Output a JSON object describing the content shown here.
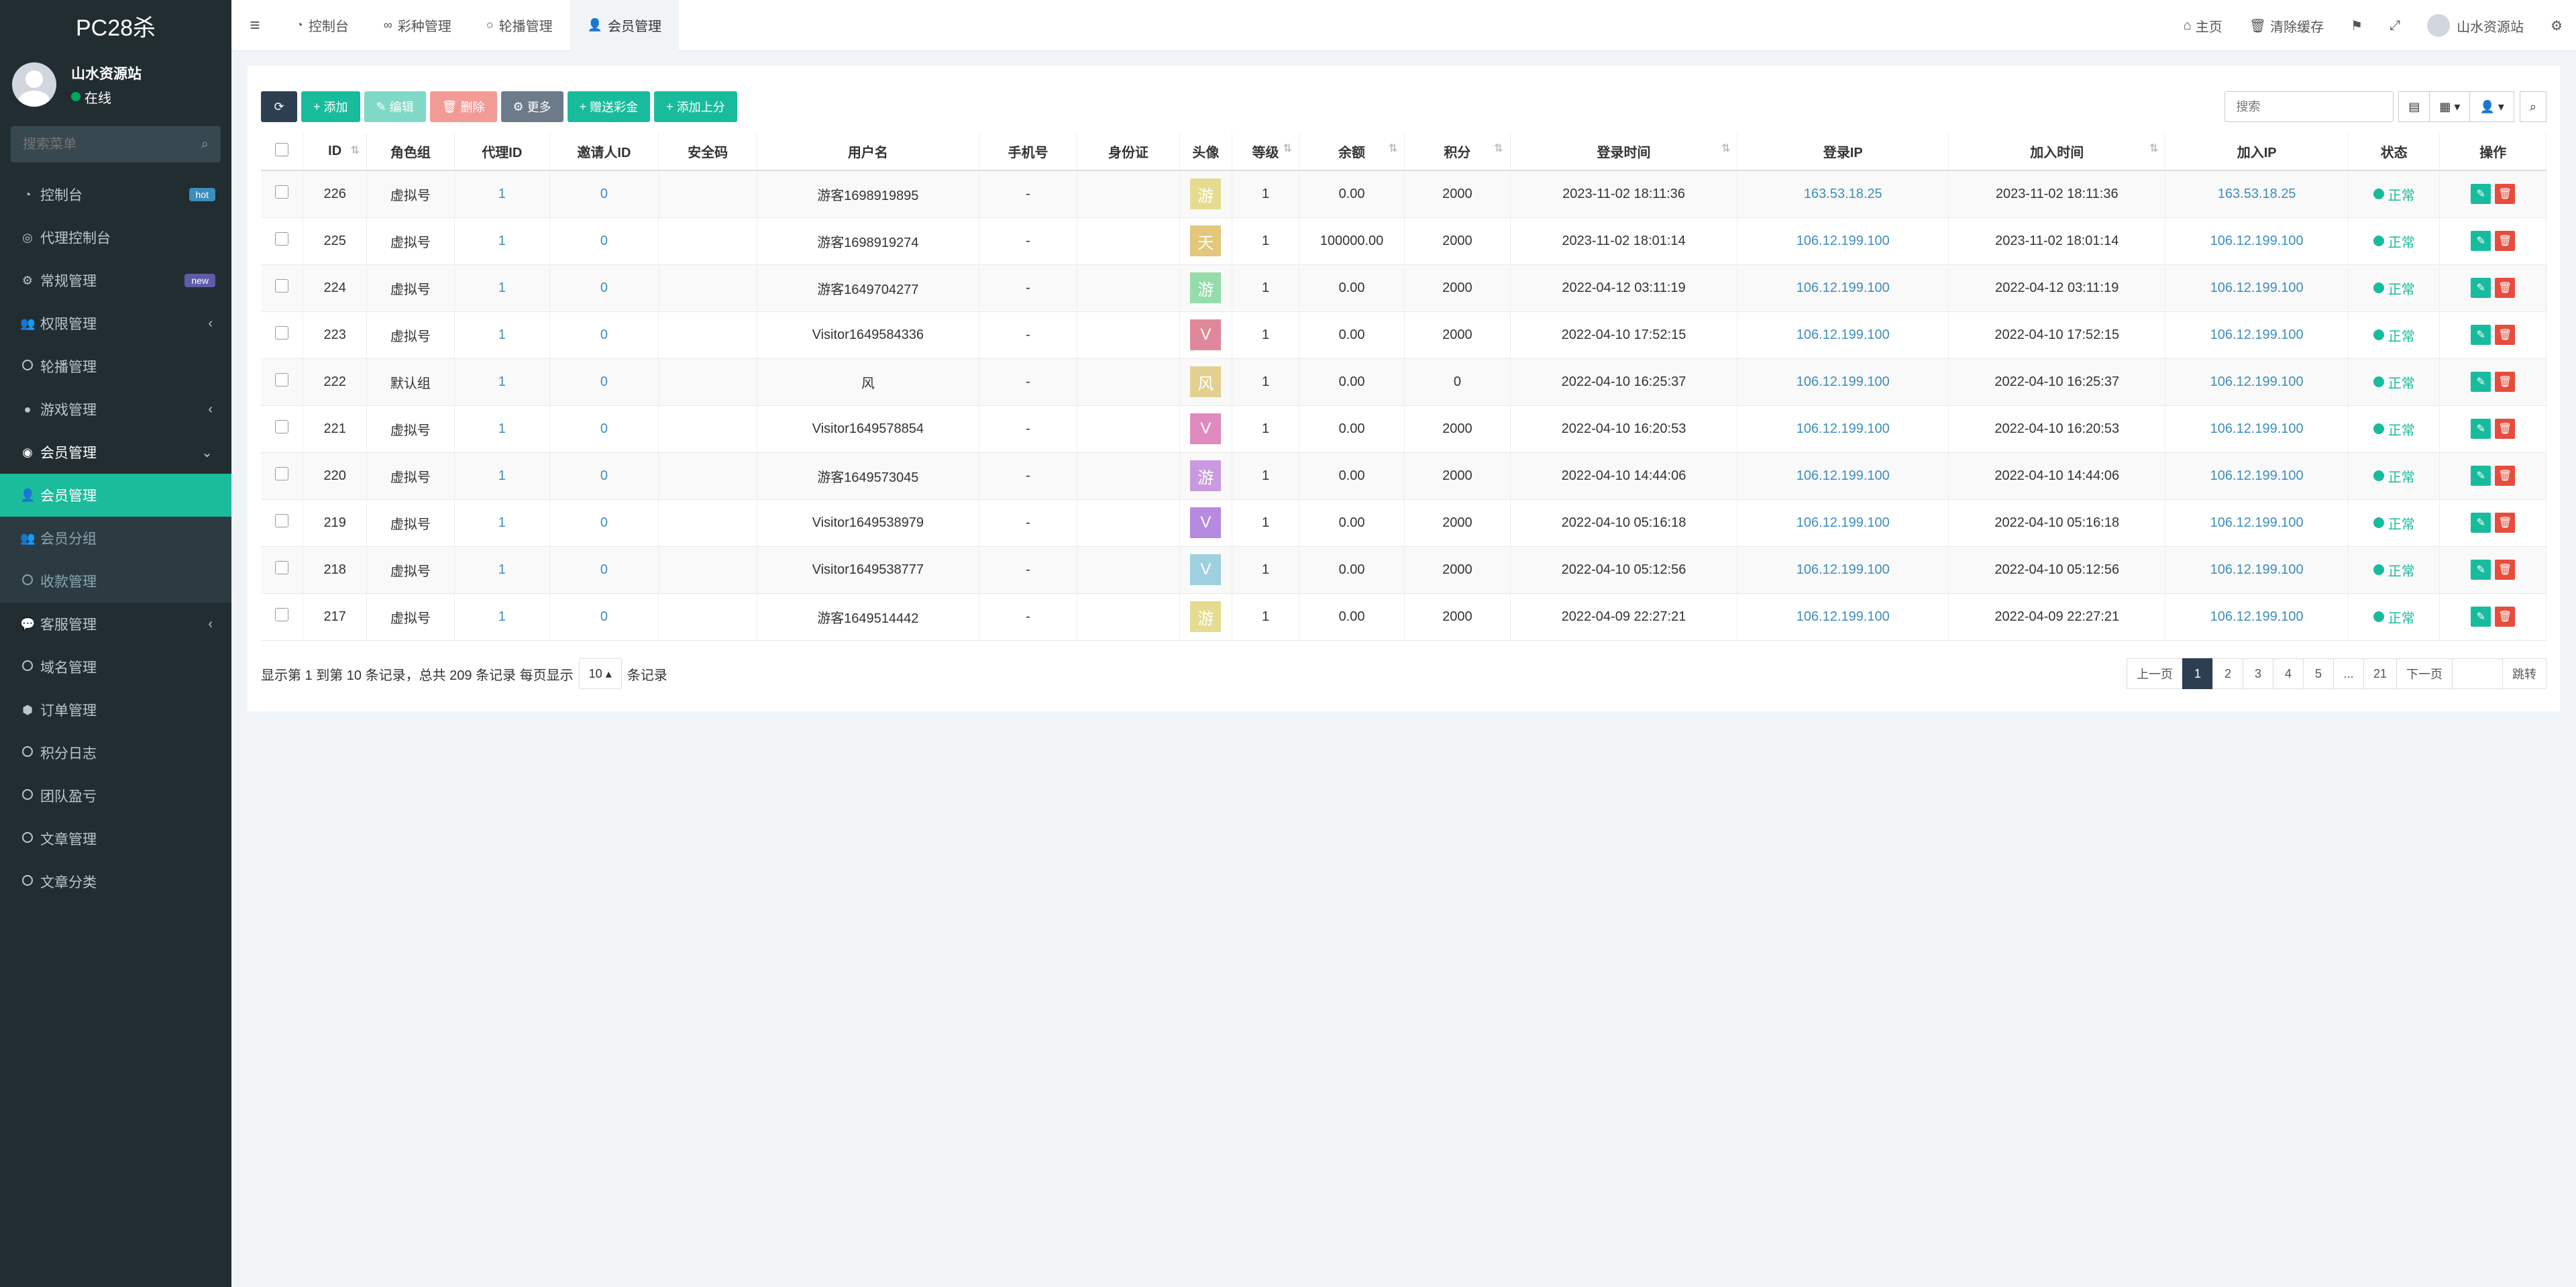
{
  "sidebar": {
    "brand": "PC28杀",
    "user_name": "山水资源站",
    "user_status": "在线",
    "search_placeholder": "搜索菜单",
    "items": [
      {
        "label": "控制台",
        "icon": "dashboard-icon",
        "glyph": "◔",
        "badge": "hot",
        "state": "normal"
      },
      {
        "label": "代理控制台",
        "icon": "gauge-icon",
        "glyph": "◎",
        "state": "normal"
      },
      {
        "label": "常规管理",
        "icon": "cogs-icon",
        "glyph": "⚙",
        "badge": "new",
        "state": "normal"
      },
      {
        "label": "权限管理",
        "icon": "group-icon",
        "glyph": "👥",
        "chevron": "‹",
        "state": "normal"
      },
      {
        "label": "轮播管理",
        "icon": "circle-icon",
        "glyph": "",
        "state": "normal"
      },
      {
        "label": "游戏管理",
        "icon": "bomb-icon",
        "glyph": "●",
        "chevron": "‹",
        "state": "normal"
      },
      {
        "label": "会员管理",
        "icon": "user-circle-icon",
        "glyph": "◉",
        "chevron": "⌄",
        "state": "open"
      },
      {
        "label": "会员管理",
        "icon": "user-icon",
        "glyph": "👤",
        "state": "active"
      },
      {
        "label": "会员分组",
        "icon": "users-icon",
        "glyph": "👥",
        "state": "sub"
      },
      {
        "label": "收款管理",
        "icon": "circle-icon",
        "glyph": "",
        "state": "sub"
      },
      {
        "label": "客服管理",
        "icon": "comments-icon",
        "glyph": "💬",
        "chevron": "‹",
        "state": "normal"
      },
      {
        "label": "域名管理",
        "icon": "circle-icon",
        "glyph": "",
        "state": "normal"
      },
      {
        "label": "订单管理",
        "icon": "cube-icon",
        "glyph": "⬢",
        "state": "normal"
      },
      {
        "label": "积分日志",
        "icon": "circle-icon",
        "glyph": "",
        "state": "normal"
      },
      {
        "label": "团队盈亏",
        "icon": "circle-icon",
        "glyph": "",
        "state": "normal"
      },
      {
        "label": "文章管理",
        "icon": "circle-icon",
        "glyph": "",
        "state": "normal"
      },
      {
        "label": "文章分类",
        "icon": "circle-icon",
        "glyph": "",
        "state": "normal"
      }
    ]
  },
  "topbar": {
    "tabs": [
      {
        "label": "控制台",
        "icon": "dashboard-icon",
        "glyph": "◔"
      },
      {
        "label": "彩种管理",
        "icon": "link-icon",
        "glyph": "∞"
      },
      {
        "label": "轮播管理",
        "icon": "circle-icon",
        "glyph": "○"
      },
      {
        "label": "会员管理",
        "icon": "user-icon",
        "glyph": "👤"
      }
    ],
    "home": "主页",
    "clear_cache": "清除缓存",
    "user": "山水资源站"
  },
  "toolbar": {
    "add": "添加",
    "edit": "编辑",
    "delete": "删除",
    "more": "更多",
    "gift": "赠送彩金",
    "add_score": "添加上分",
    "search_placeholder": "搜索"
  },
  "table": {
    "headers": [
      "ID",
      "角色组",
      "代理ID",
      "邀请人ID",
      "安全码",
      "用户名",
      "手机号",
      "身份证",
      "头像",
      "等级",
      "余额",
      "积分",
      "登录时间",
      "登录IP",
      "加入时间",
      "加入IP",
      "状态",
      "操作"
    ],
    "rows": [
      {
        "id": "226",
        "group": "虚拟号",
        "agent": "1",
        "inviter": "0",
        "code": "",
        "username": "游客1698919895",
        "phone": "-",
        "idcard": "",
        "avatar": "游",
        "avatar_color": "#e5dc8f",
        "level": "1",
        "balance": "0.00",
        "score": "2000",
        "login_time": "2023-11-02 18:11:36",
        "login_ip": "163.53.18.25",
        "join_time": "2023-11-02 18:11:36",
        "join_ip": "163.53.18.25",
        "status": "正常"
      },
      {
        "id": "225",
        "group": "虚拟号",
        "agent": "1",
        "inviter": "0",
        "code": "",
        "username": "游客1698919274",
        "phone": "-",
        "idcard": "",
        "avatar": "天",
        "avatar_color": "#e3c77b",
        "level": "1",
        "balance": "100000.00",
        "score": "2000",
        "login_time": "2023-11-02 18:01:14",
        "login_ip": "106.12.199.100",
        "join_time": "2023-11-02 18:01:14",
        "join_ip": "106.12.199.100",
        "status": "正常"
      },
      {
        "id": "224",
        "group": "虚拟号",
        "agent": "1",
        "inviter": "0",
        "code": "",
        "username": "游客1649704277",
        "phone": "-",
        "idcard": "",
        "avatar": "游",
        "avatar_color": "#95dcaa",
        "level": "1",
        "balance": "0.00",
        "score": "2000",
        "login_time": "2022-04-12 03:11:19",
        "login_ip": "106.12.199.100",
        "join_time": "2022-04-12 03:11:19",
        "join_ip": "106.12.199.100",
        "status": "正常"
      },
      {
        "id": "223",
        "group": "虚拟号",
        "agent": "1",
        "inviter": "0",
        "code": "",
        "username": "Visitor1649584336",
        "phone": "-",
        "idcard": "",
        "avatar": "V",
        "avatar_color": "#e0889a",
        "level": "1",
        "balance": "0.00",
        "score": "2000",
        "login_time": "2022-04-10 17:52:15",
        "login_ip": "106.12.199.100",
        "join_time": "2022-04-10 17:52:15",
        "join_ip": "106.12.199.100",
        "status": "正常"
      },
      {
        "id": "222",
        "group": "默认组",
        "agent": "1",
        "inviter": "0",
        "code": "",
        "username": "风",
        "phone": "-",
        "idcard": "",
        "avatar": "风",
        "avatar_color": "#e3cf8f",
        "level": "1",
        "balance": "0.00",
        "score": "0",
        "login_time": "2022-04-10 16:25:37",
        "login_ip": "106.12.199.100",
        "join_time": "2022-04-10 16:25:37",
        "join_ip": "106.12.199.100",
        "status": "正常"
      },
      {
        "id": "221",
        "group": "虚拟号",
        "agent": "1",
        "inviter": "0",
        "code": "",
        "username": "Visitor1649578854",
        "phone": "-",
        "idcard": "",
        "avatar": "V",
        "avatar_color": "#e08ac0",
        "level": "1",
        "balance": "0.00",
        "score": "2000",
        "login_time": "2022-04-10 16:20:53",
        "login_ip": "106.12.199.100",
        "join_time": "2022-04-10 16:20:53",
        "join_ip": "106.12.199.100",
        "status": "正常"
      },
      {
        "id": "220",
        "group": "虚拟号",
        "agent": "1",
        "inviter": "0",
        "code": "",
        "username": "游客1649573045",
        "phone": "-",
        "idcard": "",
        "avatar": "游",
        "avatar_color": "#c99ae0",
        "level": "1",
        "balance": "0.00",
        "score": "2000",
        "login_time": "2022-04-10 14:44:06",
        "login_ip": "106.12.199.100",
        "join_time": "2022-04-10 14:44:06",
        "join_ip": "106.12.199.100",
        "status": "正常"
      },
      {
        "id": "219",
        "group": "虚拟号",
        "agent": "1",
        "inviter": "0",
        "code": "",
        "username": "Visitor1649538979",
        "phone": "-",
        "idcard": "",
        "avatar": "V",
        "avatar_color": "#b58ae0",
        "level": "1",
        "balance": "0.00",
        "score": "2000",
        "login_time": "2022-04-10 05:16:18",
        "login_ip": "106.12.199.100",
        "join_time": "2022-04-10 05:16:18",
        "join_ip": "106.12.199.100",
        "status": "正常"
      },
      {
        "id": "218",
        "group": "虚拟号",
        "agent": "1",
        "inviter": "0",
        "code": "",
        "username": "Visitor1649538777",
        "phone": "-",
        "idcard": "",
        "avatar": "V",
        "avatar_color": "#9ed0e0",
        "level": "1",
        "balance": "0.00",
        "score": "2000",
        "login_time": "2022-04-10 05:12:56",
        "login_ip": "106.12.199.100",
        "join_time": "2022-04-10 05:12:56",
        "join_ip": "106.12.199.100",
        "status": "正常"
      },
      {
        "id": "217",
        "group": "虚拟号",
        "agent": "1",
        "inviter": "0",
        "code": "",
        "username": "游客1649514442",
        "phone": "-",
        "idcard": "",
        "avatar": "游",
        "avatar_color": "#e5dc8f",
        "level": "1",
        "balance": "0.00",
        "score": "2000",
        "login_time": "2022-04-09 22:27:21",
        "login_ip": "106.12.199.100",
        "join_time": "2022-04-09 22:27:21",
        "join_ip": "106.12.199.100",
        "status": "正常"
      }
    ]
  },
  "footer": {
    "info_prefix": "显示第 1 到第 10 条记录，总共 209 条记录 每页显示",
    "page_size": "10",
    "info_suffix": "条记录",
    "prev": "上一页",
    "pages": [
      "1",
      "2",
      "3",
      "4",
      "5",
      "...",
      "21"
    ],
    "current_page": "1",
    "next": "下一页",
    "jump": "跳转"
  },
  "colors": {
    "accent": "#18bc9c",
    "sidebar_bg": "#222d32",
    "danger": "#e74c3c",
    "link": "#3c8dbc"
  }
}
